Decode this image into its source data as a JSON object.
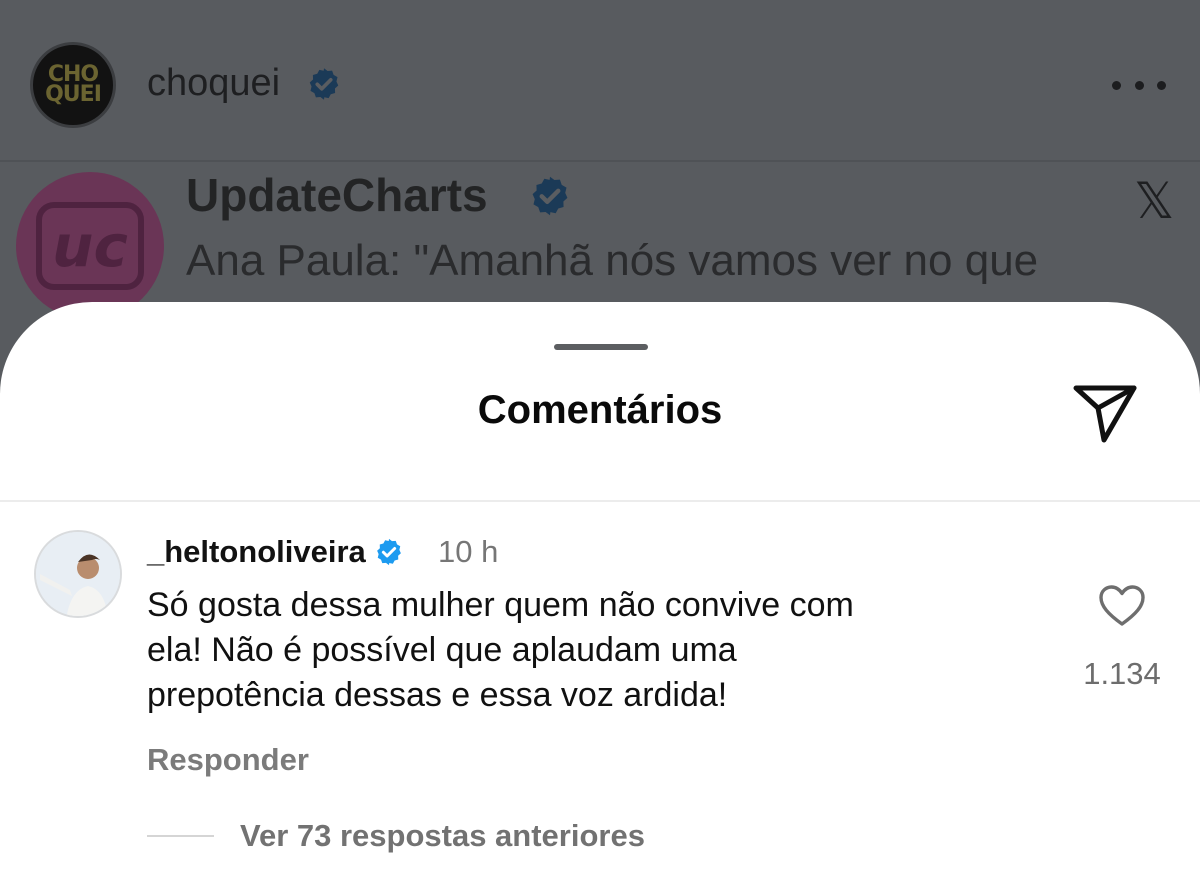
{
  "post": {
    "account": {
      "logo_text": "CHO\nQUEI",
      "name": "choquei",
      "verified_icon": "verified-badge-icon",
      "more_icon": "more-options-icon"
    },
    "embed": {
      "avatar_text": "uc",
      "name": "UpdateCharts",
      "text": "Ana Paula: \"Amanhã nós vamos ver no que",
      "platform_icon": "x-logo-icon"
    }
  },
  "comments_sheet": {
    "title": "Comentários",
    "share_icon": "send-icon",
    "comment": {
      "username": "_heltonoliveira",
      "verified_icon": "verified-badge-icon",
      "time": "10 h",
      "lines": [
        "Só gosta dessa mulher quem não convive com",
        "ela! Não é possível que aplaudam uma",
        "prepotência dessas e essa voz ardida!"
      ],
      "like_icon": "heart-icon",
      "like_count": "1.134",
      "reply_label": "Responder",
      "view_replies_label": "Ver 73 respostas anteriores"
    }
  },
  "colors": {
    "overlay": "#585b5f",
    "sheet": "#ffffff",
    "verified": "#1d9bf0",
    "text": "#111111",
    "muted": "#767676"
  }
}
